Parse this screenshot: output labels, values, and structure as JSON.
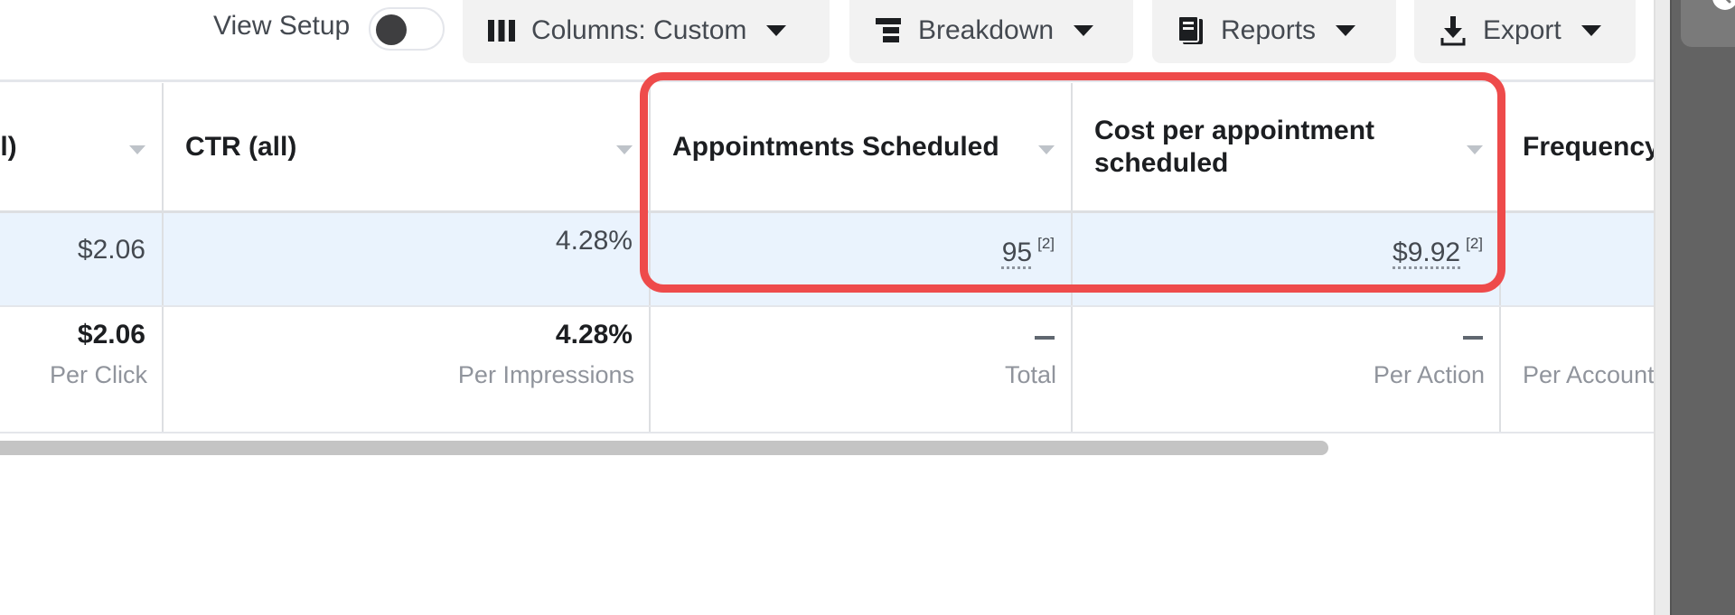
{
  "toolbar": {
    "view_setup_label": "View Setup",
    "view_setup_toggle_on": false,
    "buttons": [
      {
        "label": "Columns: Custom",
        "icon": "columns-icon"
      },
      {
        "label": "Breakdown",
        "icon": "breakdown-icon"
      },
      {
        "label": "Reports",
        "icon": "reports-icon"
      },
      {
        "label": "Export",
        "icon": "download-icon"
      }
    ]
  },
  "table": {
    "columns": [
      {
        "header": "ll)",
        "full_header_partial": true
      },
      {
        "header": "CTR (all)"
      },
      {
        "header": "Appointments Scheduled"
      },
      {
        "header": "Cost per appointment scheduled"
      },
      {
        "header": "Frequency"
      }
    ],
    "data_row": {
      "col0": "$2.06",
      "col1": "4.28%",
      "col2": {
        "value": "95",
        "footnote": "[2]"
      },
      "col3": {
        "value": "$9.92",
        "footnote": "[2]"
      },
      "col4": ""
    },
    "totals_row": {
      "col0": {
        "value": "$2.06",
        "sub": "Per Click"
      },
      "col1": {
        "value": "4.28%",
        "sub": "Per Impressions"
      },
      "col2": {
        "value": "—",
        "sub": "Total"
      },
      "col3": {
        "value": "—",
        "sub": "Per Action"
      },
      "col4": {
        "value": "",
        "sub": "Per Account"
      }
    }
  },
  "annotation": {
    "highlight_color": "#ee4b4b",
    "target": "Appointments Scheduled and Cost per appointment scheduled columns"
  },
  "side_panel": {
    "icon": "clock-icon"
  },
  "colors": {
    "row_highlight": "#eaf3fd",
    "toolbar_button_bg": "#f2f2f2",
    "side_panel_bg": "#636363"
  }
}
